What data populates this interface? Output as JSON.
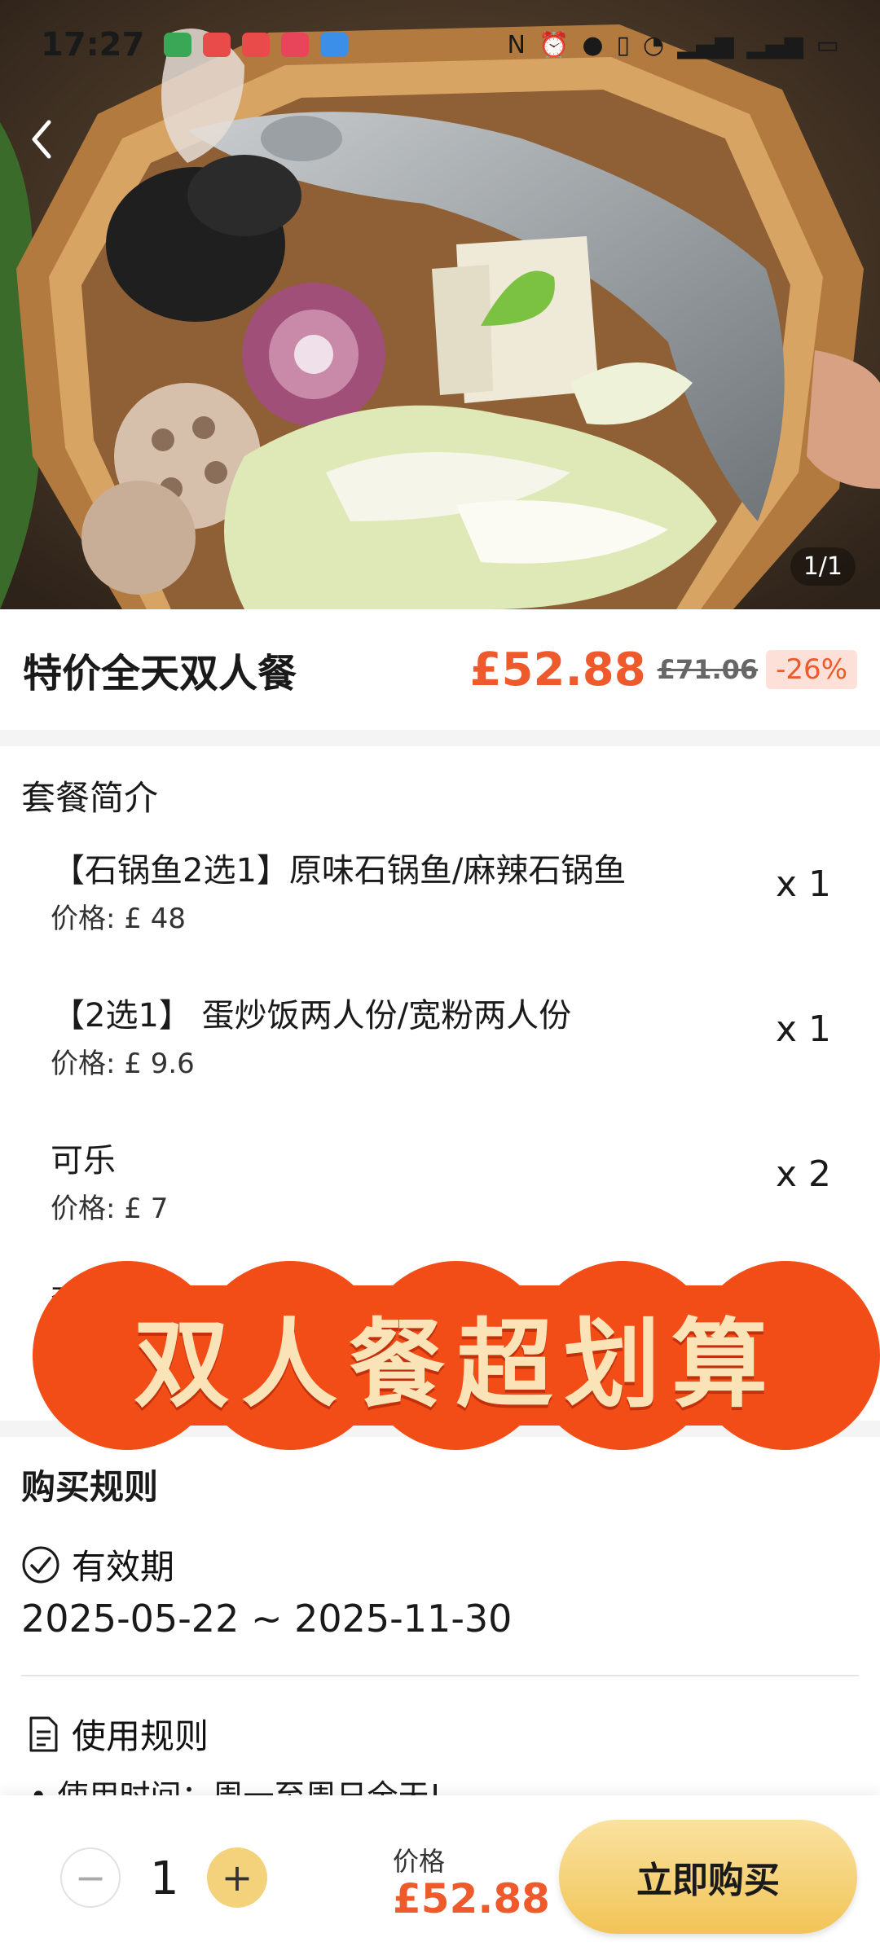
{
  "status_bar": {
    "time": "17:27",
    "app_icon_colors": [
      "#3aa757",
      "#e94b4b",
      "#e94b4b",
      "#e8455b",
      "#3b8fe8"
    ],
    "right_icons": [
      "nfc-icon",
      "alarm-icon",
      "location-icon",
      "vibrate-icon",
      "wifi-icon",
      "signal-4g-icon",
      "signal-4g-icon",
      "battery-icon"
    ]
  },
  "hero": {
    "counter": "1/1"
  },
  "product": {
    "name": "特价全天双人餐",
    "price": "£52.88",
    "original_price": "£71.06",
    "discount": "-26%"
  },
  "package": {
    "title": "套餐简介",
    "items": [
      {
        "name": "【石锅鱼2选1】原味石锅鱼/麻辣石锅鱼",
        "price": "价格: £ 48",
        "qty": "x 1"
      },
      {
        "name": "【2选1】 蛋炒饭两人份/宽粉两人份",
        "price": "价格: £ 9.6",
        "qty": "x 1"
      },
      {
        "name": "可乐",
        "price": "价格: £ 7",
        "qty": "x 2"
      }
    ],
    "partially_hidden_text": "套"
  },
  "promo": {
    "text": "双人餐超划算",
    "color": "#f24d16"
  },
  "rules": {
    "title": "购买规则",
    "validity_label": "有效期",
    "validity_dates": "2025-05-22 ~ 2025-11-30",
    "usage_label": "使用规则",
    "usage_line": "• 使用时间：周一至周日全天!"
  },
  "bottom_bar": {
    "minus": "−",
    "quantity": "1",
    "plus": "+",
    "price_label": "价格",
    "price": "£52.88",
    "buy_label": "立即购买"
  },
  "colors": {
    "accent": "#ee5a2b",
    "buy_button": "#f2c457"
  }
}
